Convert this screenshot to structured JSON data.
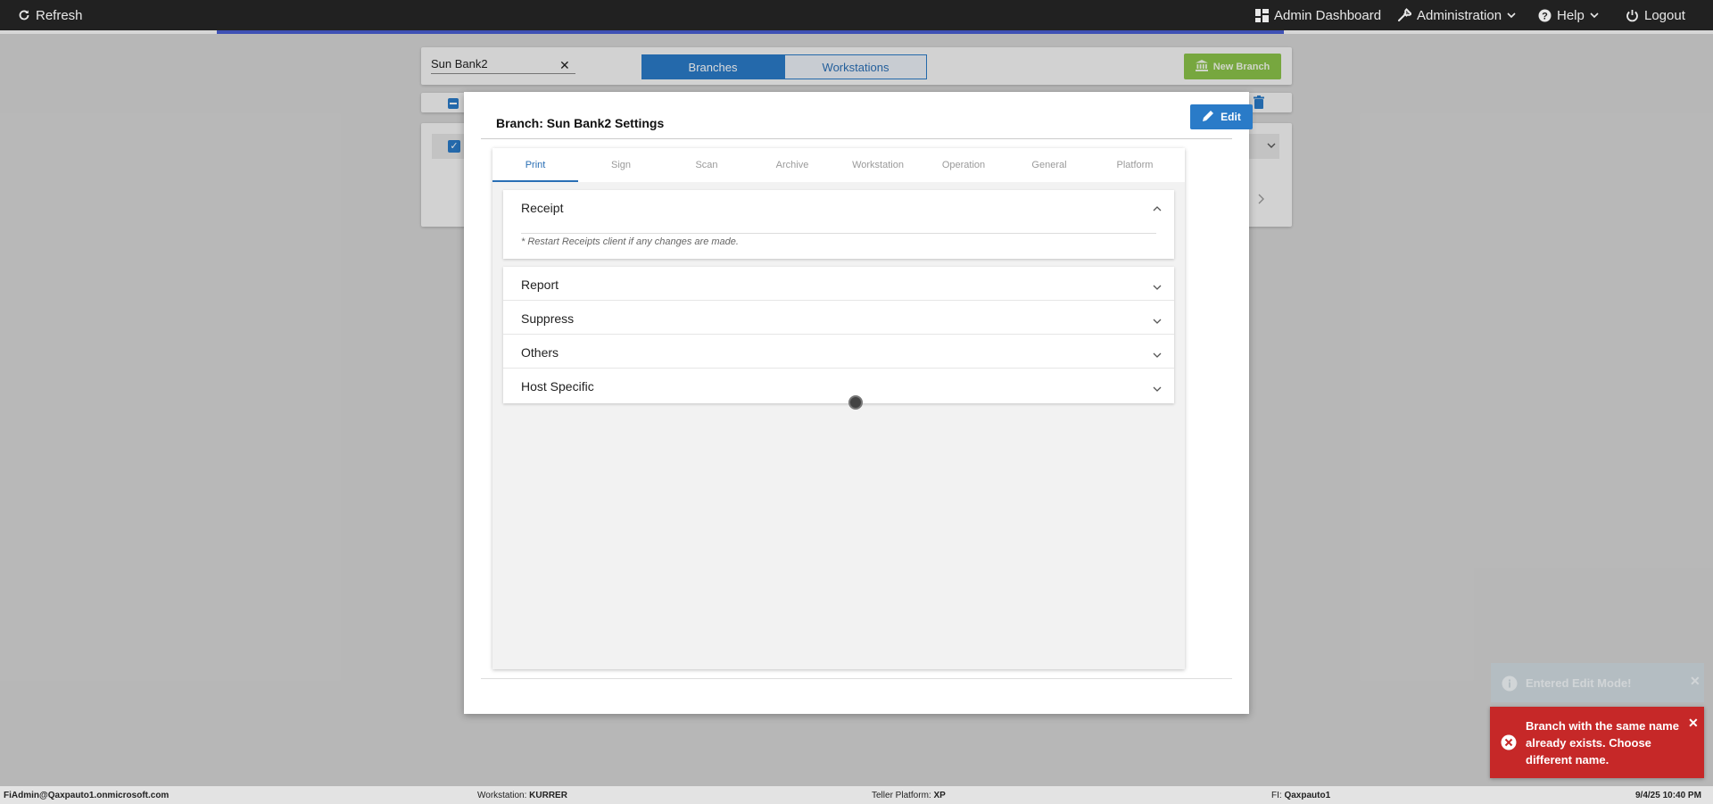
{
  "topbar": {
    "refresh_label": "Refresh",
    "admin_dashboard_label": "Admin Dashboard",
    "administration_label": "Administration",
    "help_label": "Help",
    "logout_label": "Logout"
  },
  "background": {
    "search_value": "Sun Bank2",
    "branches_tab": "Branches",
    "workstations_tab": "Workstations",
    "new_branch_label": "New Branch"
  },
  "modal": {
    "title": "Branch: Sun Bank2 Settings",
    "edit_label": "Edit",
    "tabs": [
      "Print",
      "Sign",
      "Scan",
      "Archive",
      "Workstation",
      "Operation",
      "General",
      "Platform"
    ],
    "active_tab": "Print",
    "receipt": {
      "title": "Receipt",
      "note": "* Restart Receipts client if any changes are made."
    },
    "sections": [
      "Report",
      "Suppress",
      "Others",
      "Host Specific"
    ]
  },
  "toasts": {
    "info": "Entered Edit Mode!",
    "error": "Branch with the same name already exists. Choose different name."
  },
  "statusbar": {
    "user": "FiAdmin@Qaxpauto1.onmicrosoft.com",
    "workstation_label": "Workstation:",
    "workstation_value": "KURRER",
    "teller_label": "Teller Platform:",
    "teller_value": "XP",
    "fi_label": "FI:",
    "fi_value": "Qaxpauto1",
    "datetime": "9/4/25 10:40 PM"
  },
  "colors": {
    "topbar": "#212121",
    "primary": "#2a7bc8",
    "success": "#8bc34a",
    "error": "#c62828"
  }
}
